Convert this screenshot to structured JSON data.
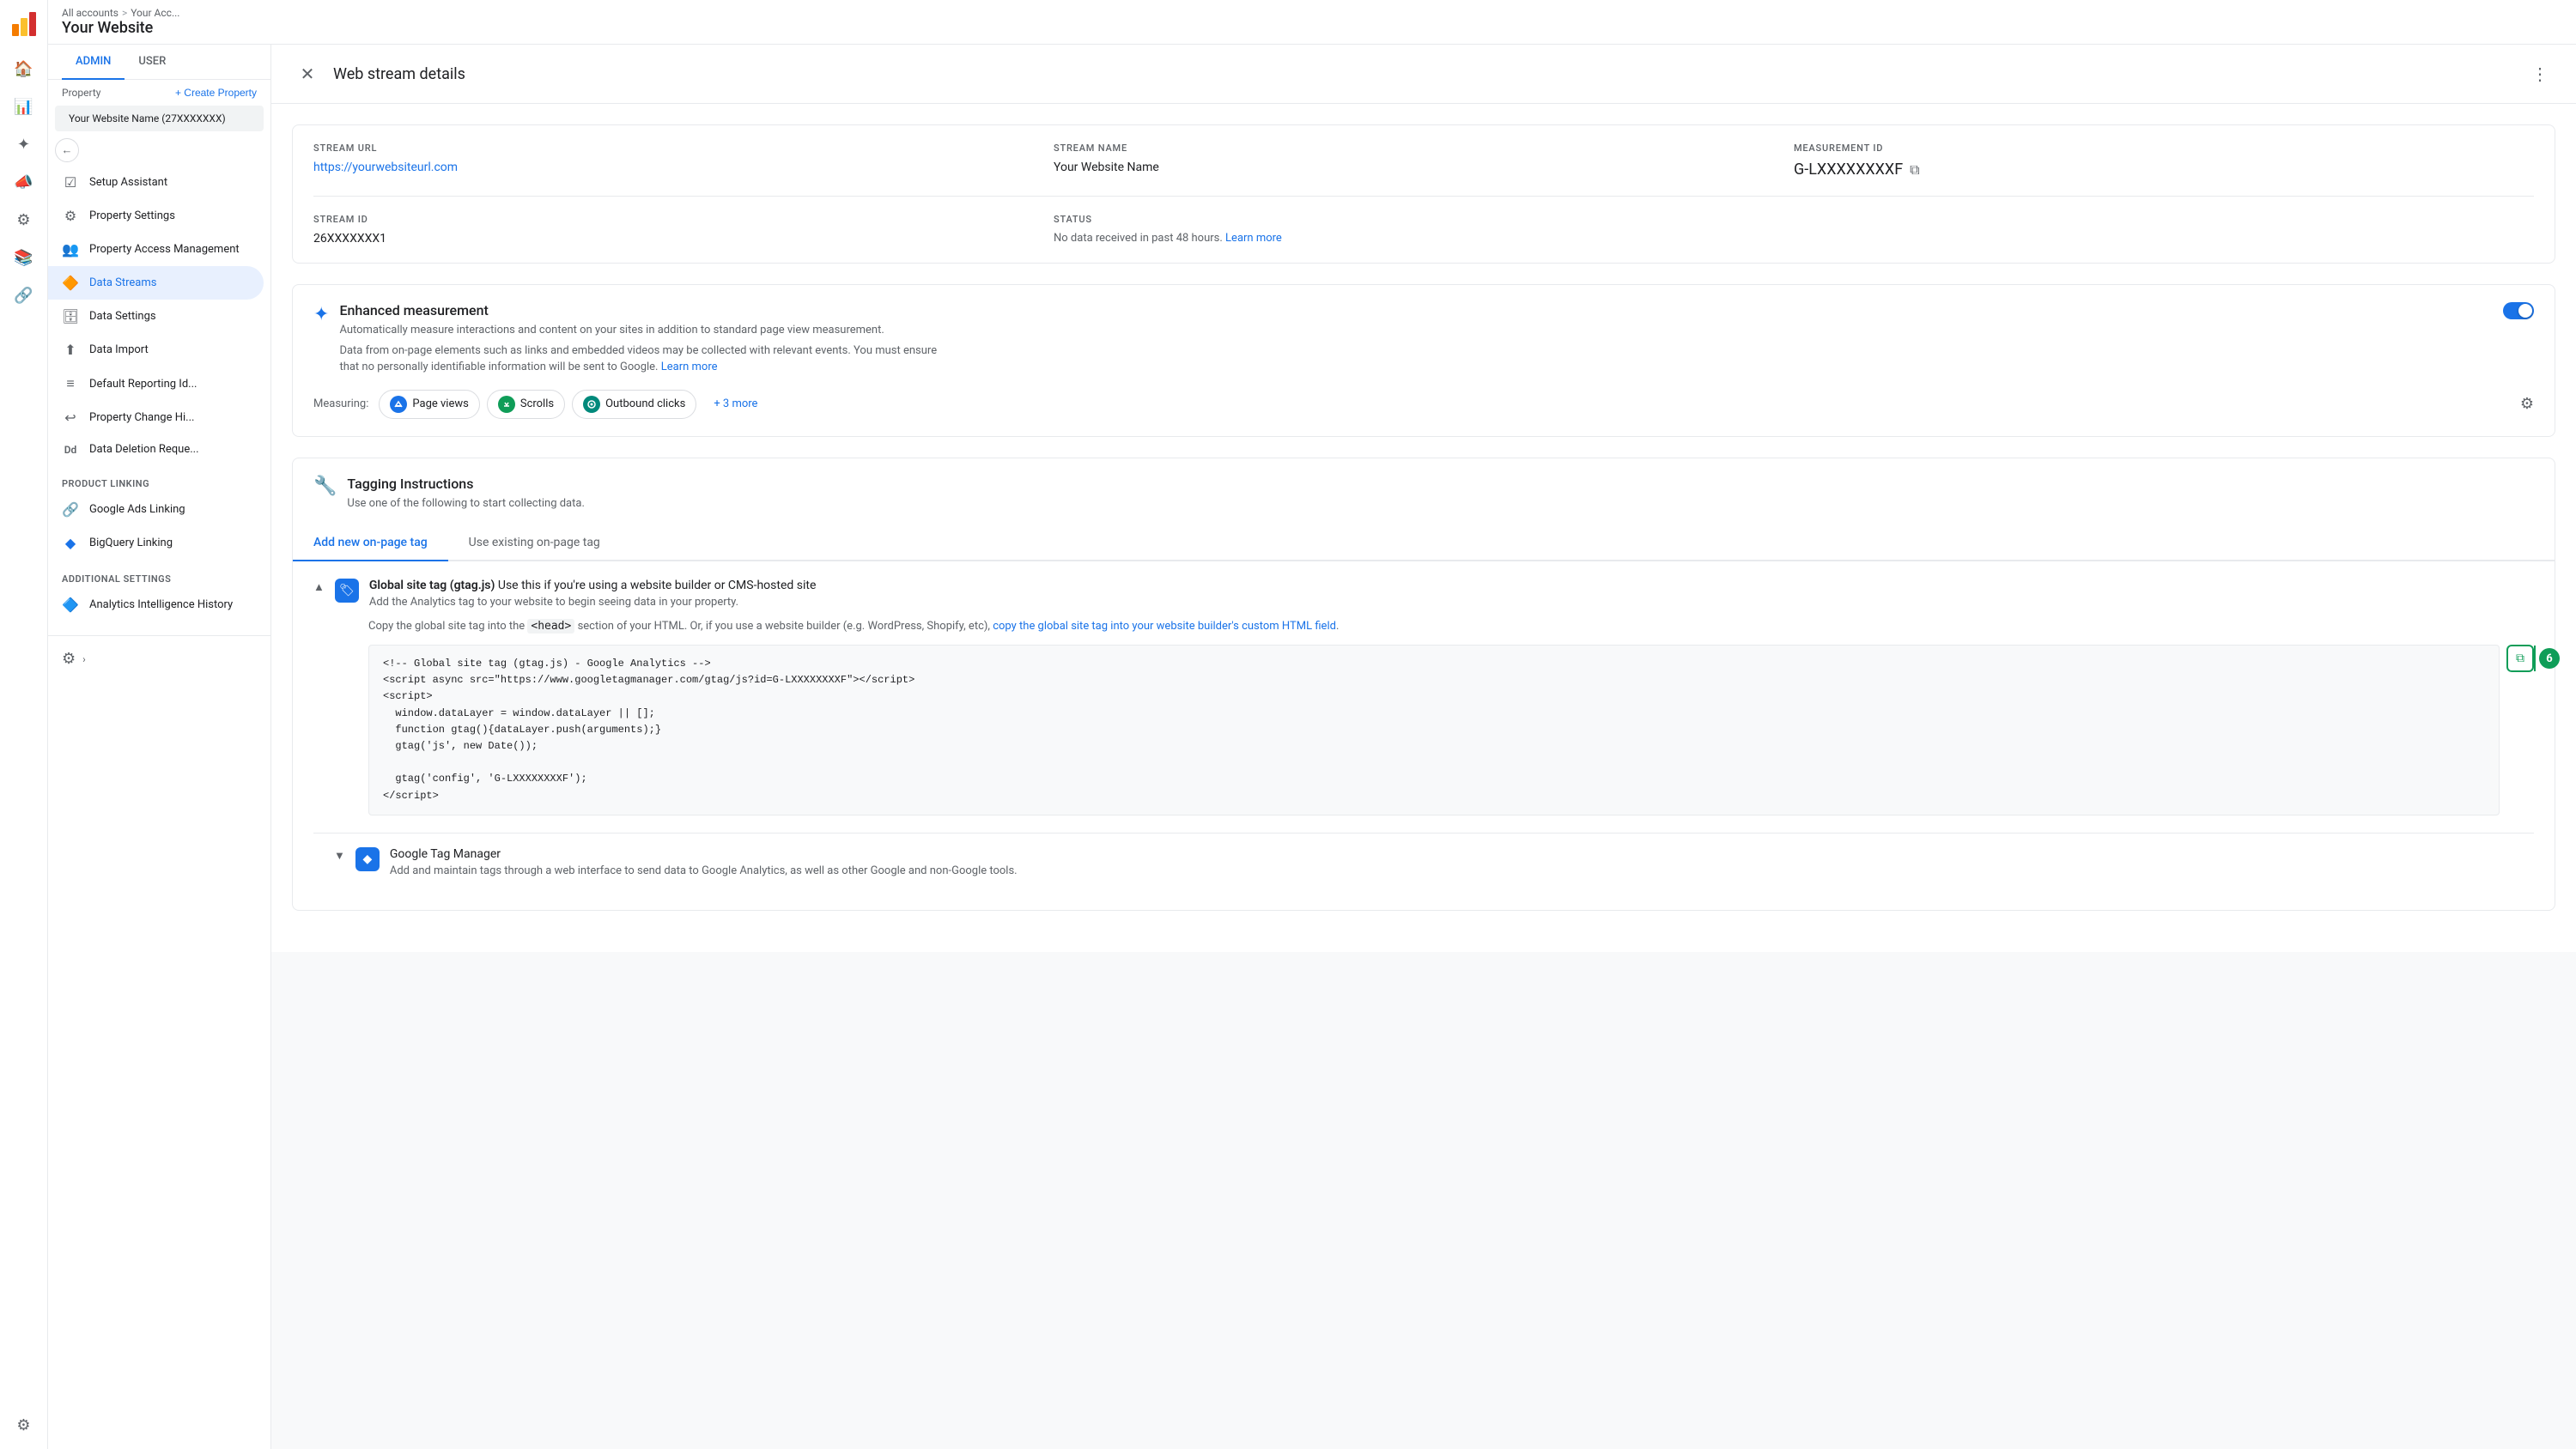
{
  "app": {
    "name": "Analytics",
    "logo_color_orange": "#F57C00",
    "logo_color_yellow": "#FBC02D",
    "logo_color_red": "#D32F2F"
  },
  "breadcrumb": {
    "all_accounts": "All accounts",
    "separator": ">",
    "your_account": "Your Acc...",
    "separator2": ">",
    "your_website": "Your Website"
  },
  "sidebar": {
    "admin_tab": "ADMIN",
    "user_tab": "USER",
    "property_label": "Property",
    "create_property_btn": "+ Create Property",
    "property_name": "Your Website Name (27XXXXXXX)",
    "menu_items": [
      {
        "id": "setup-assistant",
        "label": "Setup Assistant",
        "icon": "☑"
      },
      {
        "id": "property-settings",
        "label": "Property Settings",
        "icon": "⚙"
      },
      {
        "id": "property-access",
        "label": "Property Access Management",
        "icon": "👥"
      },
      {
        "id": "data-streams",
        "label": "Data Streams",
        "icon": "🔶",
        "active": true
      },
      {
        "id": "data-settings",
        "label": "Data Settings",
        "icon": "🗄"
      },
      {
        "id": "data-import",
        "label": "Data Import",
        "icon": "⬆"
      },
      {
        "id": "default-reporting",
        "label": "Default Reporting Id...",
        "icon": "≡"
      },
      {
        "id": "property-change",
        "label": "Property Change Hi...",
        "icon": "↩"
      },
      {
        "id": "data-deletion",
        "label": "Data Deletion Reque...",
        "icon": "Dd"
      }
    ],
    "product_linking_label": "PRODUCT LINKING",
    "product_linking_items": [
      {
        "id": "google-ads",
        "label": "Google Ads Linking"
      },
      {
        "id": "bigquery",
        "label": "BigQuery Linking",
        "icon": "◆"
      }
    ],
    "additional_settings_label": "ADDITIONAL SETTINGS",
    "additional_settings_items": [
      {
        "id": "analytics-intelligence",
        "label": "Analytics Intelligence History",
        "icon": "🔷"
      }
    ]
  },
  "modal": {
    "title": "Web stream details",
    "stream_url_label": "STREAM URL",
    "stream_url_value": "https://yourwebsiteurl.com",
    "stream_name_label": "STREAM NAME",
    "stream_name_value": "Your Website Name",
    "measurement_id_label": "MEASUREMENT ID",
    "measurement_id_value": "G-LXXXXXXXXF",
    "stream_id_label": "STREAM ID",
    "stream_id_value": "26XXXXXXX1",
    "status_label": "STATUS",
    "status_value": "No data received in past 48 hours.",
    "status_link": "Learn more",
    "enhanced_measurement": {
      "title": "Enhanced measurement",
      "description": "Automatically measure interactions and content on your sites in addition to standard page view measurement.",
      "description2": "Data from on-page elements such as links and embedded videos may be collected with relevant events. You must ensure that no personally identifiable information will be sent to Google.",
      "learn_more": "Learn more",
      "measuring_label": "Measuring:",
      "pills": [
        {
          "id": "page-views",
          "label": "Page views",
          "dot_color": "blue",
          "icon": "P"
        },
        {
          "id": "scrolls",
          "label": "Scrolls",
          "dot_color": "green",
          "icon": "S"
        },
        {
          "id": "outbound-clicks",
          "label": "Outbound clicks",
          "dot_color": "teal",
          "icon": "O"
        }
      ],
      "more_label": "+ 3 more"
    },
    "tagging": {
      "title": "Tagging Instructions",
      "subtitle": "Use one of the following to start collecting data.",
      "tab_add_new": "Add new on-page tag",
      "tab_existing": "Use existing on-page tag",
      "global_site_tag": {
        "title_prefix": "Global site tag (gtag.js)",
        "title_suffix": " Use this if you're using a website builder or CMS-hosted site",
        "desc": "Add the Analytics tag to your website to begin seeing data in your property.",
        "instruction": "Copy the global site tag into the ",
        "instruction_code": "<head>",
        "instruction_suffix": " section of your HTML. Or, if you use a website builder (e.g. WordPress, Shopify, etc), ",
        "instruction_link": "copy the global site tag into your website builder's custom HTML field",
        "instruction_end": ".",
        "code": "<!-- Global site tag (gtag.js) - Google Analytics -->\n<script async src=\"https://www.googletagmanager.com/gtag/js?id=G-LXXXXXXXXF\"></script>\n<script>\n  window.dataLayer = window.dataLayer || [];\n  function gtag(){dataLayer.push(arguments);}\n  gtag('js', new Date());\n\n  gtag('config', 'G-LXXXXXXXXF');\n</script>"
      },
      "google_tag_manager": {
        "title": "Google Tag Manager",
        "desc": "Add and maintain tags through a web interface to send data to Google Analytics, as well as other Google and non-Google tools."
      }
    }
  },
  "icons": {
    "close": "✕",
    "more_vert": "⋮",
    "back": "←",
    "copy": "⧉",
    "settings": "⚙",
    "chevron_up": "▲",
    "chevron_down": "▼",
    "sparkle": "✦",
    "wrench": "🔧",
    "tag_icon": "🏷",
    "step_number": "6"
  }
}
